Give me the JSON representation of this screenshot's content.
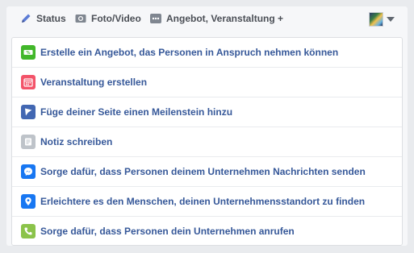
{
  "composer": {
    "tabs": {
      "status": "Status",
      "photo_video": "Foto/Video",
      "more": "Angebot, Veranstaltung +"
    }
  },
  "menu": {
    "items": [
      {
        "label": "Erstelle ein Angebot, das Personen in Anspruch nehmen können",
        "icon": "offer-icon",
        "color": "#42b72a"
      },
      {
        "label": "Veranstaltung erstellen",
        "icon": "calendar-icon",
        "color": "#f35369"
      },
      {
        "label": "Füge deiner Seite einen Meilenstein hinzu",
        "icon": "flag-icon",
        "color": "#4267b2"
      },
      {
        "label": "Notiz schreiben",
        "icon": "note-icon",
        "color": "#bec3c9"
      },
      {
        "label": "Sorge dafür, dass Personen deinem Unternehmen Nachrichten senden",
        "icon": "messenger-icon",
        "color": "#1877f2"
      },
      {
        "label": "Erleichtere es den Menschen, deinen Unternehmensstandort zu finden",
        "icon": "location-pin-icon",
        "color": "#1877f2"
      },
      {
        "label": "Sorge dafür, dass Personen dein Unternehmen anrufen",
        "icon": "phone-icon",
        "color": "#8bc34a"
      }
    ]
  }
}
